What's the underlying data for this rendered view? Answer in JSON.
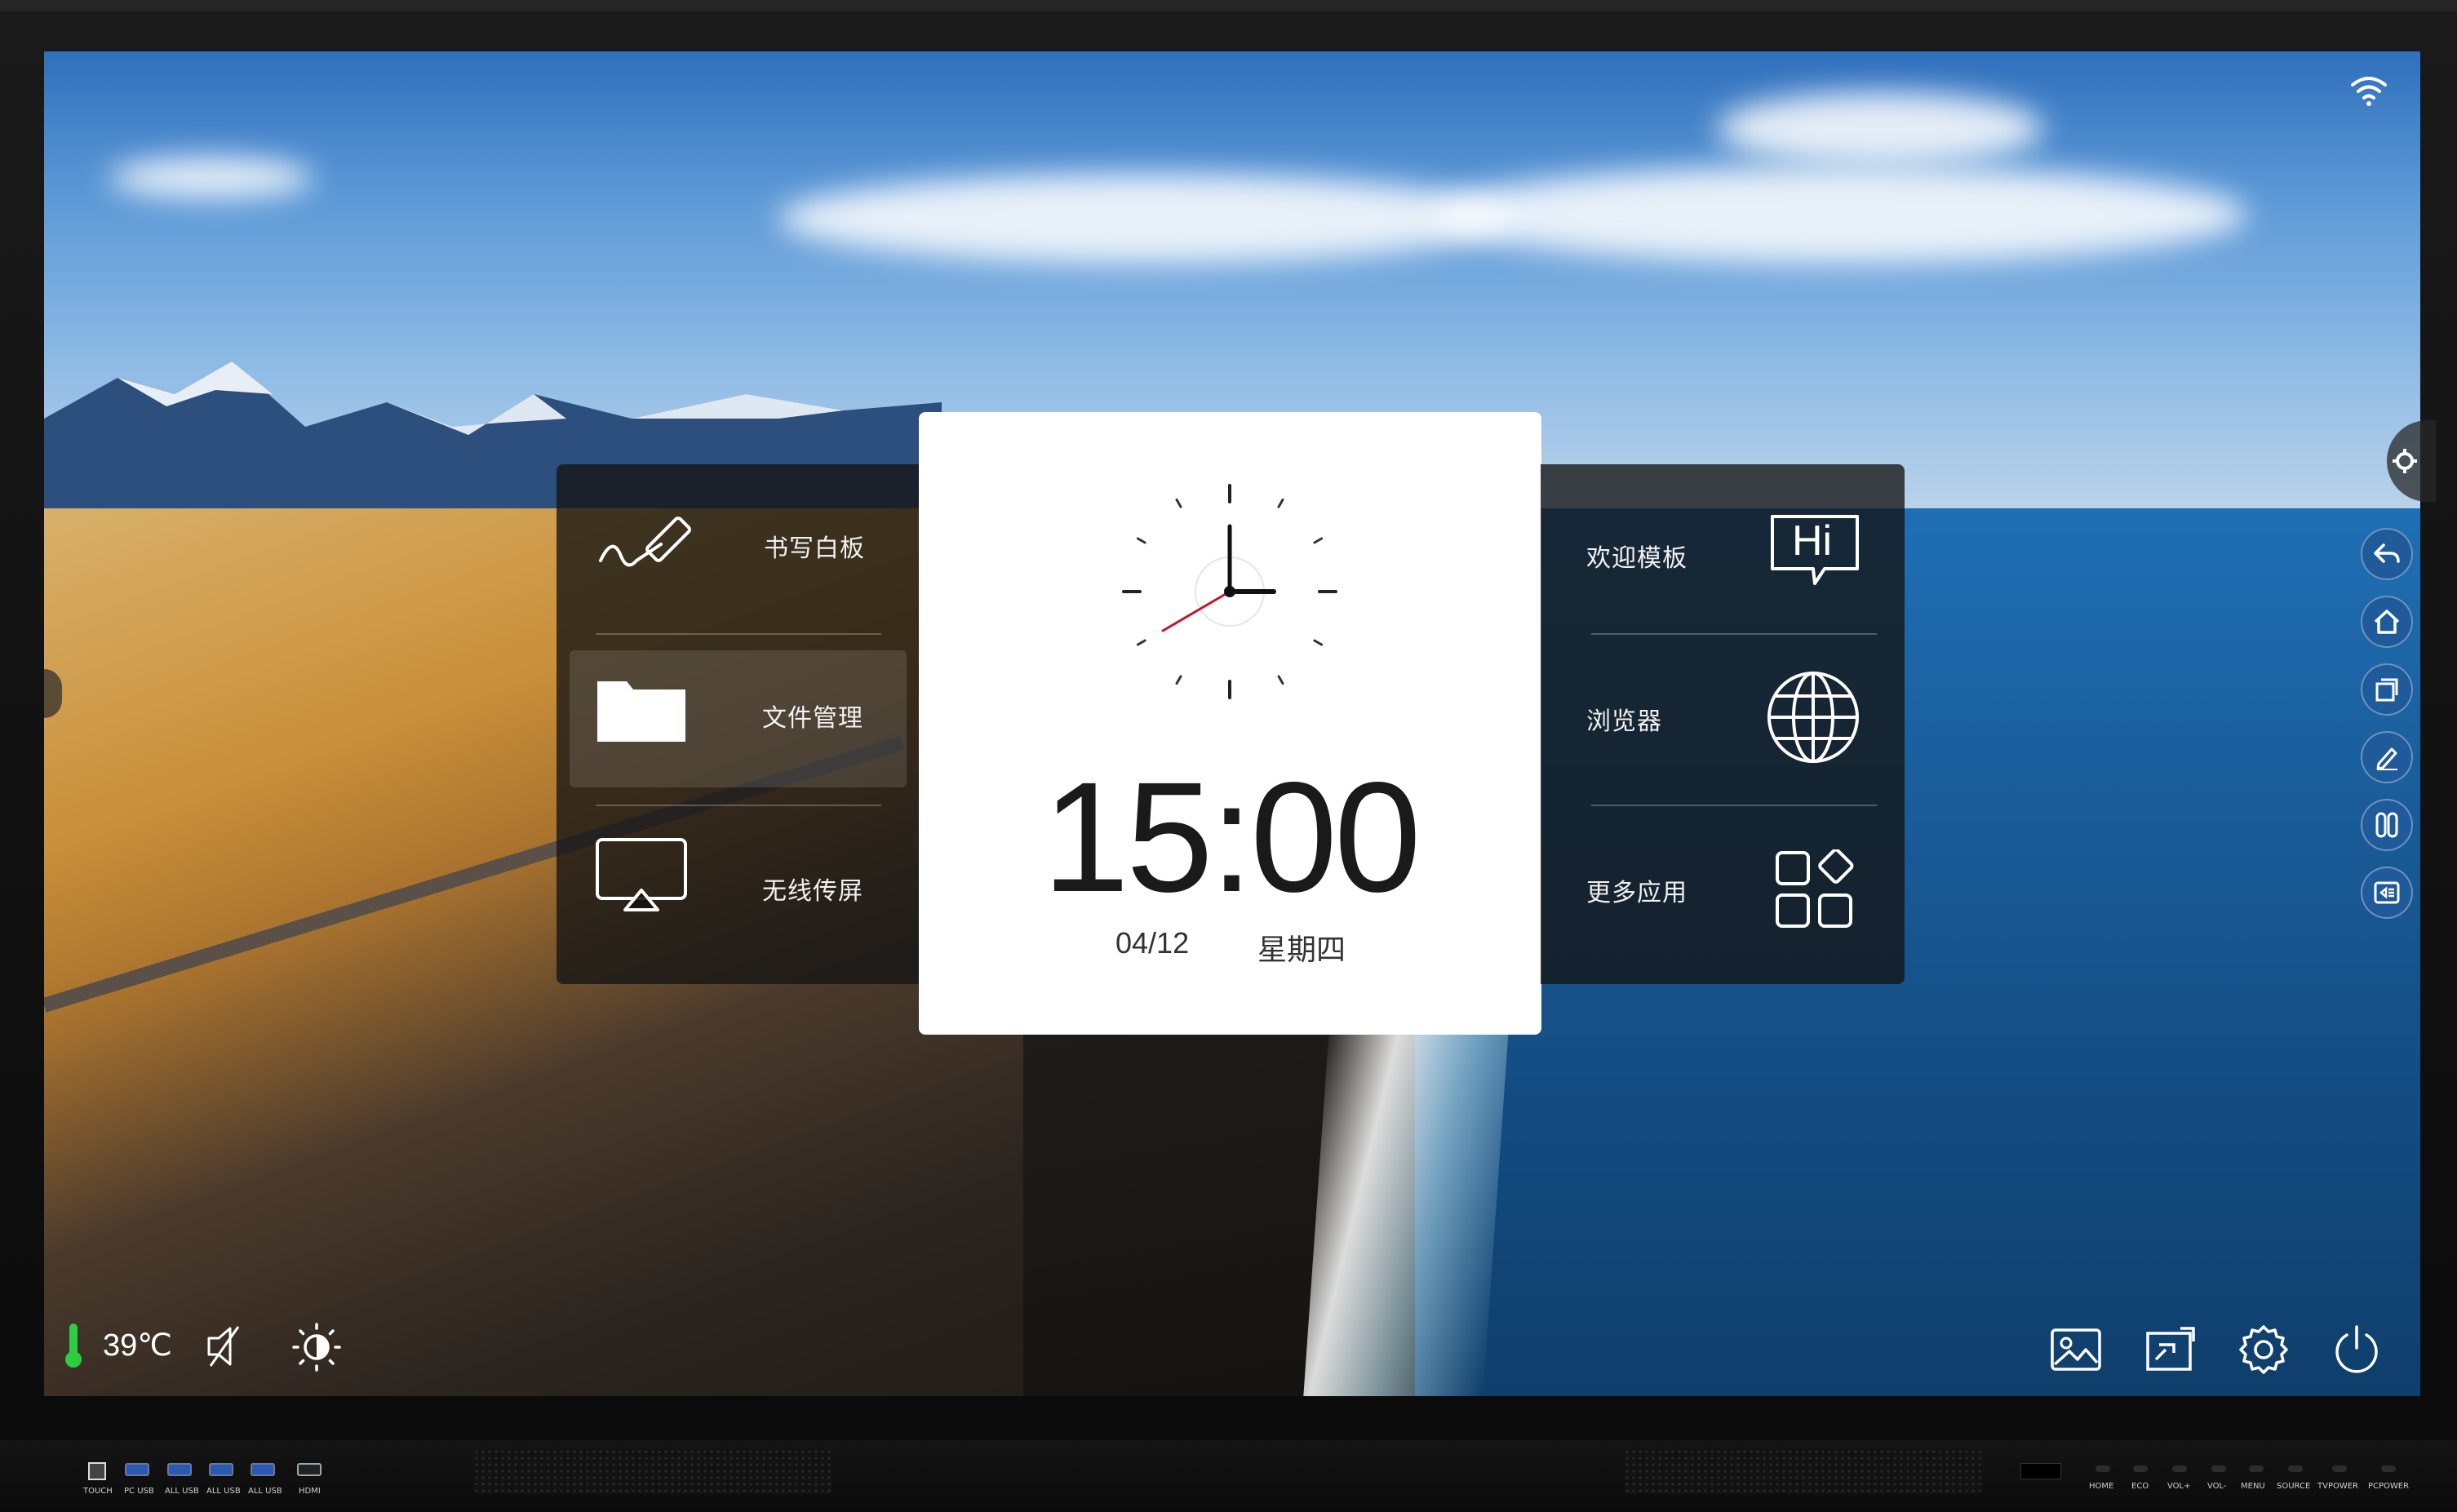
{
  "menu_left": {
    "items": [
      {
        "label": "书写白板",
        "icon": "pen-icon"
      },
      {
        "label": "文件管理",
        "icon": "folder-icon"
      },
      {
        "label": "无线传屏",
        "icon": "airplay-icon"
      }
    ]
  },
  "menu_right": {
    "items": [
      {
        "label": "欢迎模板",
        "icon": "hi-bubble-icon",
        "icon_text": "Hi"
      },
      {
        "label": "浏览器",
        "icon": "globe-icon"
      },
      {
        "label": "更多应用",
        "icon": "apps-grid-icon"
      }
    ]
  },
  "clock": {
    "time": "15:00",
    "date": "04/12",
    "weekday": "星期四"
  },
  "status": {
    "temperature": "39℃"
  },
  "side_toolbar": [
    "back-icon",
    "home-icon",
    "windows-icon",
    "annotate-icon",
    "multitask-icon",
    "input-source-icon"
  ],
  "bottom_dock": [
    "wallpaper-icon",
    "screen-icon",
    "settings-icon",
    "power-icon"
  ],
  "front_ports": [
    "TOUCH",
    "PC USB",
    "ALL USB",
    "ALL USB",
    "ALL USB",
    "HDMI"
  ],
  "front_keys": [
    "HOME",
    "ECO",
    "VOL+",
    "VOL-",
    "MENU",
    "SOURCE",
    "TVPOWER",
    "PCPOWER"
  ],
  "colors": {
    "accent_blue": "#1f5a9a",
    "panel_dark": "#141414",
    "thermometer_green": "#2ecc40",
    "clock_second_hand": "#c0182a"
  }
}
